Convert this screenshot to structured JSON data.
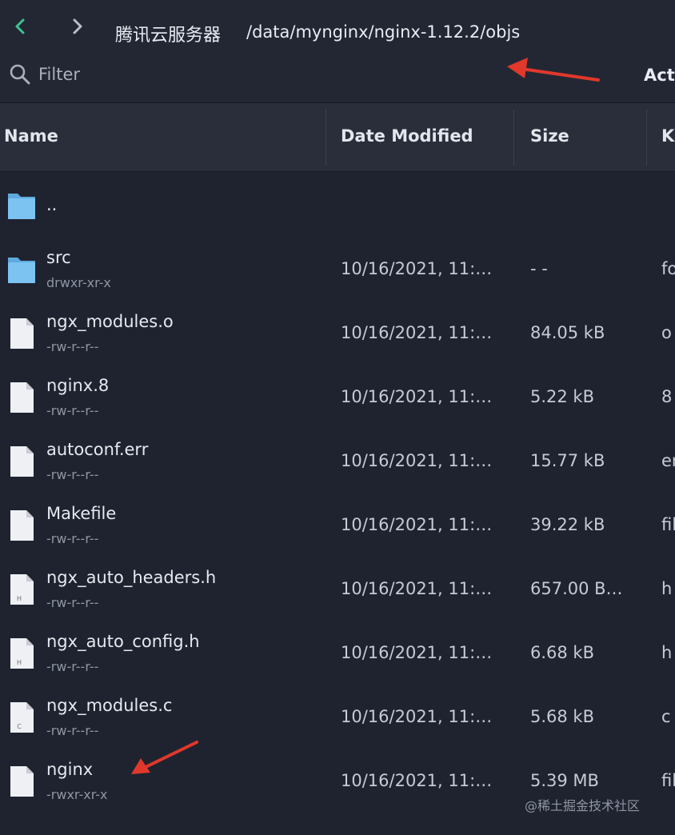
{
  "toolbar": {
    "server_name": "腾讯云服务器",
    "path": "/data/mynginx/nginx-1.12.2/objs",
    "filter_placeholder": "Filter",
    "actions_label": "Act"
  },
  "columns": [
    "Name",
    "Date Modified",
    "Size",
    "K"
  ],
  "files": [
    {
      "name": "..",
      "perm": "",
      "date": "",
      "size": "",
      "kind": "",
      "icon": "folder-icon"
    },
    {
      "name": "src",
      "perm": "drwxr-xr-x",
      "date": "10/16/2021, 11:2…",
      "size": "- -",
      "kind": "fo",
      "icon": "folder-icon"
    },
    {
      "name": "ngx_modules.o",
      "perm": "-rw-r--r--",
      "date": "10/16/2021, 11:2…",
      "size": "84.05 kB",
      "kind": "o",
      "icon": "file-icon"
    },
    {
      "name": "nginx.8",
      "perm": "-rw-r--r--",
      "date": "10/16/2021, 11:2…",
      "size": "5.22 kB",
      "kind": "8",
      "icon": "file-icon"
    },
    {
      "name": "autoconf.err",
      "perm": "-rw-r--r--",
      "date": "10/16/2021, 11:2…",
      "size": "15.77 kB",
      "kind": "er",
      "icon": "file-icon"
    },
    {
      "name": "Makefile",
      "perm": "-rw-r--r--",
      "date": "10/16/2021, 11:2…",
      "size": "39.22 kB",
      "kind": "fil",
      "icon": "file-icon"
    },
    {
      "name": "ngx_auto_headers.h",
      "perm": "-rw-r--r--",
      "date": "10/16/2021, 11:2…",
      "size": "657.00 B…",
      "kind": "h",
      "icon": "header-file-icon"
    },
    {
      "name": "ngx_auto_config.h",
      "perm": "-rw-r--r--",
      "date": "10/16/2021, 11:2…",
      "size": "6.68 kB",
      "kind": "h",
      "icon": "header-file-icon"
    },
    {
      "name": "ngx_modules.c",
      "perm": "-rw-r--r--",
      "date": "10/16/2021, 11:2…",
      "size": "5.68 kB",
      "kind": "c",
      "icon": "c-file-icon"
    },
    {
      "name": "nginx",
      "perm": "-rwxr-xr-x",
      "date": "10/16/2021, 11:2…",
      "size": "5.39 MB",
      "kind": "fil",
      "icon": "file-icon"
    }
  ],
  "file_badges": {
    "header-file-icon": "H",
    "c-file-icon": "C"
  },
  "watermark": "@稀土掘金技术社区",
  "colors": {
    "accent_green": "#3ec28f",
    "annotation_red": "#e0382b",
    "folder_blue": "#7cc3f2"
  }
}
